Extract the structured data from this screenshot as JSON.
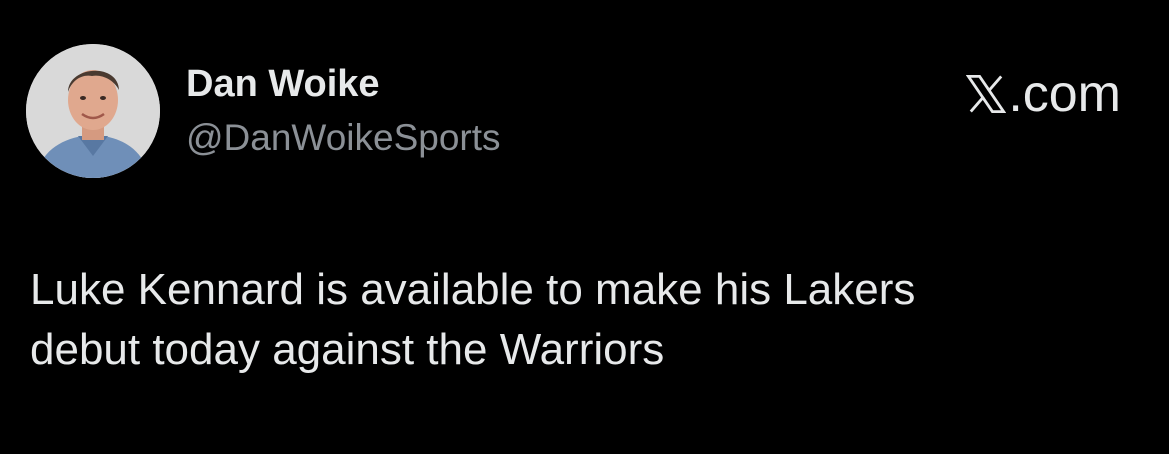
{
  "author": {
    "display_name": "Dan Woike",
    "handle": "@DanWoikeSports",
    "avatar_icon": "profile-photo"
  },
  "brand": {
    "icon": "x-logo-icon",
    "suffix": ".com"
  },
  "tweet": {
    "lines": [
      "Luke Kennard is available to make his Lakers",
      "debut today against the Warriors"
    ]
  },
  "colors": {
    "background": "#000000",
    "text": "#e7e9ea",
    "secondary_text": "#8b9096"
  }
}
